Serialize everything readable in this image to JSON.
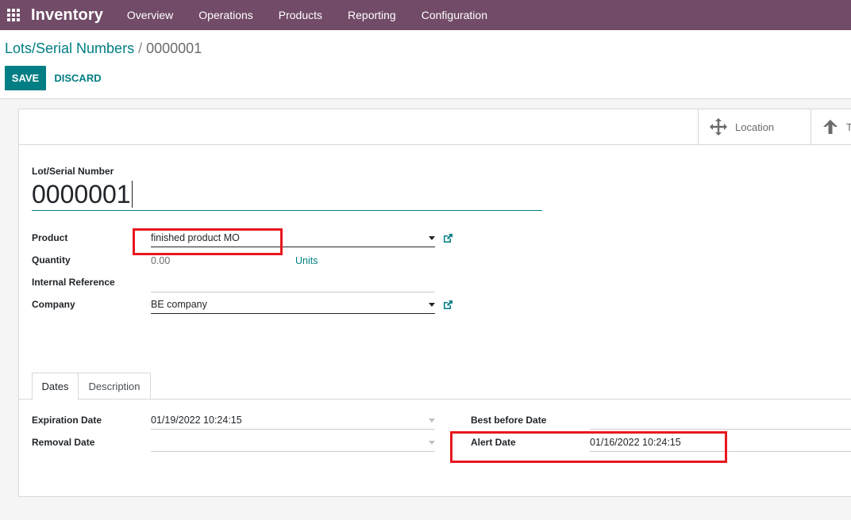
{
  "navbar": {
    "app_title": "Inventory",
    "menu": [
      "Overview",
      "Operations",
      "Products",
      "Reporting",
      "Configuration"
    ]
  },
  "breadcrumb": {
    "parent": "Lots/Serial Numbers",
    "separator": "/",
    "current": "0000001"
  },
  "actions": {
    "save_label": "SAVE",
    "discard_label": "DISCARD"
  },
  "smart_buttons": {
    "location_label": "Location",
    "traceability_label": "T"
  },
  "form": {
    "lot_label": "Lot/Serial Number",
    "lot_value": "0000001",
    "product_label": "Product",
    "product_value": "finished product MO",
    "quantity_label": "Quantity",
    "quantity_value": "0.00",
    "quantity_uom": "Units",
    "internal_ref_label": "Internal Reference",
    "internal_ref_value": "",
    "company_label": "Company",
    "company_value": "BE company"
  },
  "tabs": {
    "dates": "Dates",
    "description": "Description"
  },
  "dates": {
    "expiration_label": "Expiration Date",
    "expiration_value": "01/19/2022 10:24:15",
    "removal_label": "Removal Date",
    "removal_value": "",
    "best_before_label": "Best before Date",
    "best_before_value": "",
    "alert_label": "Alert Date",
    "alert_value": "01/16/2022 10:24:15"
  },
  "colors": {
    "navbar": "#714b67",
    "primary": "#017e84",
    "highlight": "#e8171e"
  }
}
